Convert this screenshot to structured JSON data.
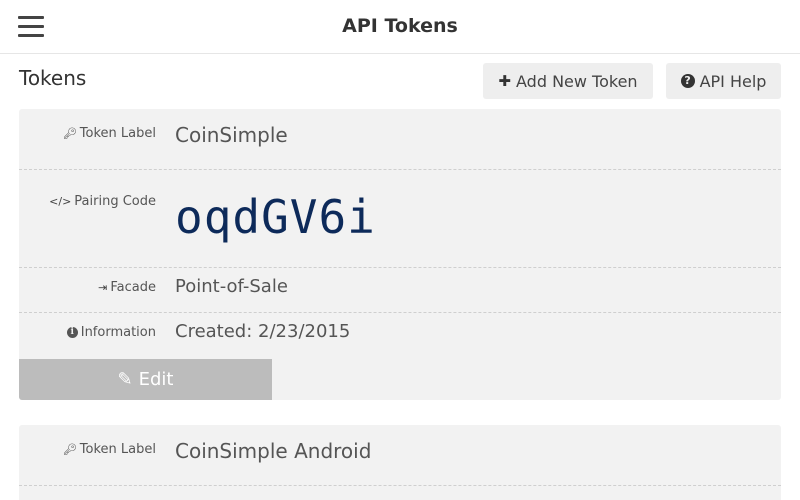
{
  "header": {
    "title": "API Tokens",
    "menu_icon": "hamburger-icon"
  },
  "section": {
    "title": "Tokens"
  },
  "actions": {
    "add_label": "Add New Token",
    "add_icon": "plus-icon",
    "help_label": "API Help",
    "help_icon": "question-circle-icon"
  },
  "tokens": [
    {
      "label_caption": "Token Label",
      "label_value": "CoinSimple",
      "pairing_caption": "Pairing Code",
      "pairing_value": "oqdGV6i",
      "facade_caption": "Facade",
      "facade_value": "Point-of-Sale",
      "info_caption": "Information",
      "info_value": "Created: 2/23/2015",
      "edit_label": "Edit"
    },
    {
      "label_caption": "Token Label",
      "label_value": "CoinSimple Android"
    }
  ],
  "colors": {
    "pairing_code": "#0d2a5a",
    "card_bg": "#f2f2f2",
    "edit_bg": "#bcbcbc"
  }
}
